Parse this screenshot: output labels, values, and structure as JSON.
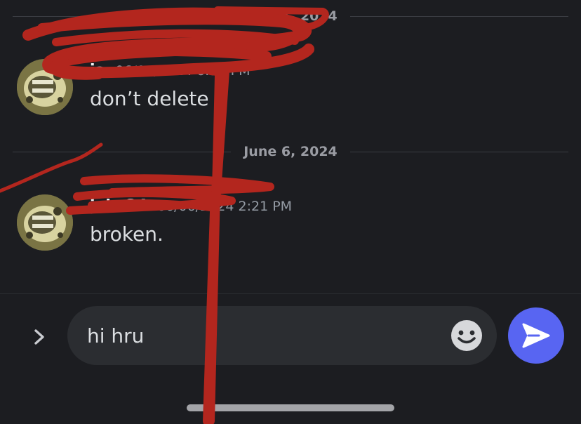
{
  "dividers": [
    {
      "date": "June 1, 2024"
    },
    {
      "date": "June 6, 2024"
    }
  ],
  "messages": [
    {
      "username": "ja",
      "timestamp": "06/01/2024 6:57 PM",
      "text": "don’t delete"
    },
    {
      "username": "jake34",
      "timestamp": "06/06/2024 2:21 PM",
      "text": "broken."
    }
  ],
  "composer": {
    "value": "hi hru",
    "expand_icon": "chevron-right-icon",
    "emoji_icon": "smiley-icon",
    "send_icon": "send-arrow-icon"
  },
  "colors": {
    "background": "#1c1d21",
    "input": "#2b2d31",
    "accent": "#5865f2",
    "redaction": "#b3261e"
  }
}
